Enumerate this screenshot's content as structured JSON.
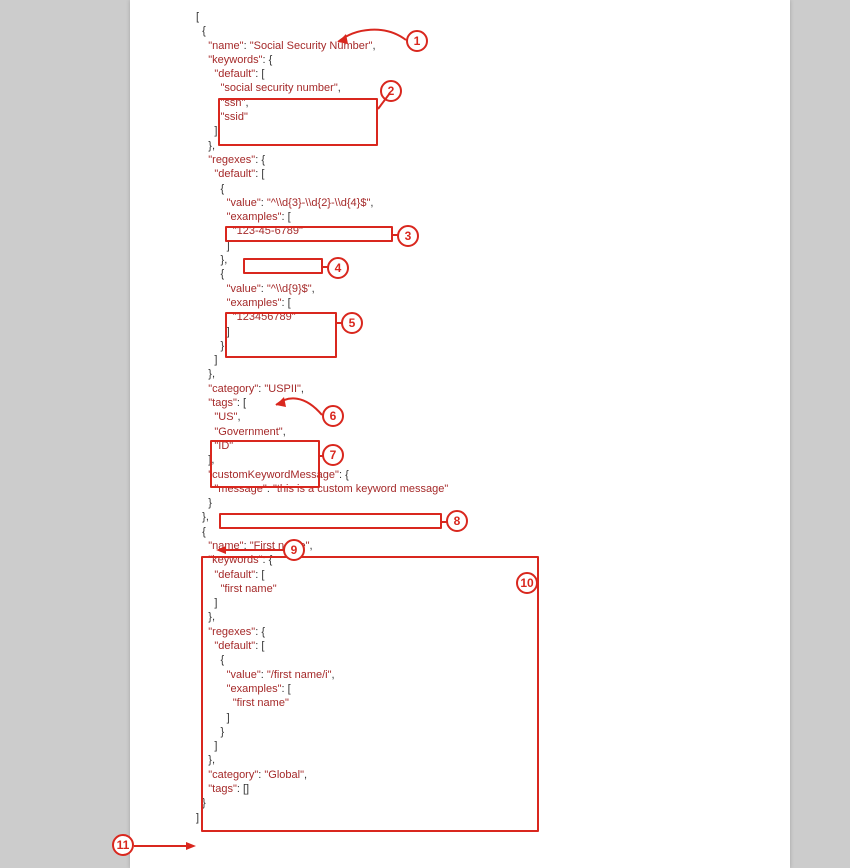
{
  "code_lines": [
    "[",
    "  {",
    "    \"name\": \"Social Security Number\",",
    "    \"keywords\": {",
    "      \"default\": [",
    "        \"social security number\",",
    "        \"ssn\",",
    "        \"ssid\"",
    "      ]",
    "    },",
    "    \"regexes\": {",
    "      \"default\": [",
    "        {",
    "          \"value\": \"^\\\\d{3}-\\\\d{2}-\\\\d{4}$\",",
    "          \"examples\": [",
    "            \"123-45-6789\"",
    "          ]",
    "        },",
    "        {",
    "          \"value\": \"^\\\\d{9}$\",",
    "          \"examples\": [",
    "            \"123456789\"",
    "          ]",
    "        }",
    "      ]",
    "    },",
    "    \"category\": \"USPII\",",
    "    \"tags\": [",
    "      \"US\",",
    "      \"Government\",",
    "      \"ID\"",
    "    ],",
    "    \"customKeywordMessage\": {",
    "      \"message\": \"this is a custom keyword message\"",
    "    }",
    "  },",
    "  {",
    "    \"name\": \"First name\",",
    "    \"keywords\": {",
    "      \"default\": [",
    "        \"first name\"",
    "      ]",
    "    },",
    "    \"regexes\": {",
    "      \"default\": [",
    "        {",
    "          \"value\": \"/first name/i\",",
    "          \"examples\": [",
    "            \"first name\"",
    "          ]",
    "        }",
    "      ]",
    "    },",
    "    \"category\": \"Global\",",
    "    \"tags\": []",
    "  }",
    "]"
  ],
  "callouts": {
    "c1": "1",
    "c2": "2",
    "c3": "3",
    "c4": "4",
    "c5": "5",
    "c6": "6",
    "c7": "7",
    "c8": "8",
    "c9": "9",
    "c10": "10",
    "c11": "11"
  }
}
